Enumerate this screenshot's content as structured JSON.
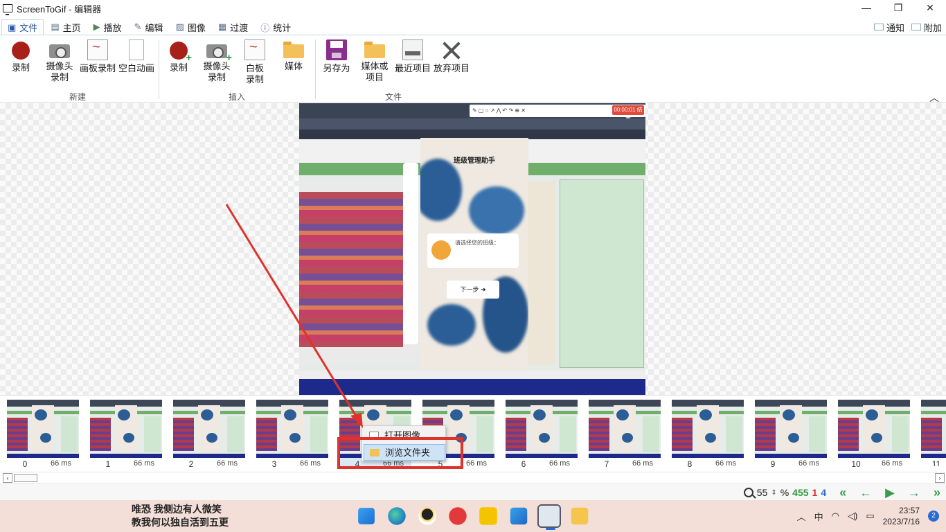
{
  "window": {
    "title": "ScreenToGif - 编辑器",
    "minimize": "—",
    "restore": "❐",
    "close": "✕"
  },
  "tabs": [
    {
      "label": "文件",
      "icon": "save-icon",
      "active": true
    },
    {
      "label": "主页",
      "icon": "home-icon"
    },
    {
      "label": "播放",
      "icon": "play-icon"
    },
    {
      "label": "编辑",
      "icon": "pencil-icon"
    },
    {
      "label": "图像",
      "icon": "image-icon"
    },
    {
      "label": "过渡",
      "icon": "transition-icon"
    },
    {
      "label": "统计",
      "icon": "info-icon"
    }
  ],
  "tabs_right": {
    "notify": "通知",
    "extra": "附加"
  },
  "ribbon": {
    "new_group": {
      "label": "新建",
      "record": "录制",
      "webcam_l1": "摄像头",
      "webcam_l2": "录制",
      "board": "画板录制",
      "blank": "空白动画"
    },
    "insert_group": {
      "label": "插入",
      "record": "录制",
      "webcam_l1": "摄像头",
      "webcam_l2": "录制",
      "board_l1": "白板",
      "board_l2": "录制",
      "media": "媒体"
    },
    "file_group": {
      "label": "文件",
      "save_as": "另存为",
      "media_l1": "媒体或",
      "media_l2": "项目",
      "recent": "最近项目",
      "discard": "放弃项目"
    }
  },
  "preview": {
    "recorder_button": "00:00:01 结束",
    "phone_title": "班级管理助手",
    "phone_prompt": "请选择您的班级：",
    "next_button": "下一步"
  },
  "frames": [
    {
      "index": "0",
      "delay": "66 ms"
    },
    {
      "index": "1",
      "delay": "66 ms"
    },
    {
      "index": "2",
      "delay": "66 ms"
    },
    {
      "index": "3",
      "delay": "66 ms"
    },
    {
      "index": "4",
      "delay": "66 ms"
    },
    {
      "index": "5",
      "delay": "66 ms"
    },
    {
      "index": "6",
      "delay": "66 ms"
    },
    {
      "index": "7",
      "delay": "66 ms"
    },
    {
      "index": "8",
      "delay": "66 ms"
    },
    {
      "index": "9",
      "delay": "66 ms"
    },
    {
      "index": "10",
      "delay": "66 ms"
    },
    {
      "index": "11",
      "delay": ""
    }
  ],
  "context_menu": {
    "open_image": "打开图像",
    "browse_folder": "浏览文件夹"
  },
  "statusbar": {
    "zoom_value": "55",
    "zoom_unit": "%",
    "frame_count": "455",
    "selected_count": "1",
    "current_frame": "4"
  },
  "taskbar": {
    "lyric_line1": "唯恐 我侧边有人微笑",
    "lyric_line2": "教我何以独自活到五更",
    "time": "23:57",
    "date": "2023/7/16",
    "notifications": "2",
    "ime": "中"
  },
  "colors": {
    "accent": "#2a5aa8",
    "highlight_box": "#e0322c",
    "arrow": "#e0322c",
    "frame_count_green": "#2e9a3a"
  }
}
